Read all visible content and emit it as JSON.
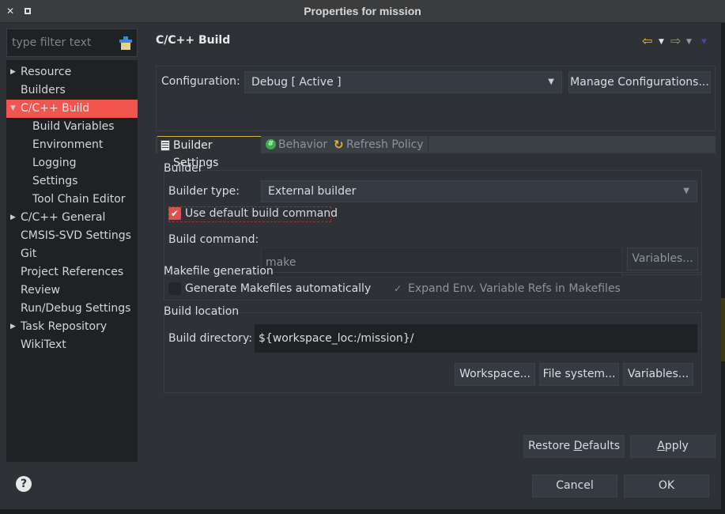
{
  "window": {
    "title": "Properties for mission",
    "close_glyph": "✕",
    "maximize_glyph": ""
  },
  "sidebar": {
    "filter_placeholder": "type filter text",
    "items": [
      {
        "label": "Resource",
        "level": 0,
        "expandable": true,
        "expanded": false
      },
      {
        "label": "Builders",
        "level": 0,
        "expandable": false
      },
      {
        "label": "C/C++ Build",
        "level": 0,
        "expandable": true,
        "expanded": true,
        "selected": true
      },
      {
        "label": "Build Variables",
        "level": 1
      },
      {
        "label": "Environment",
        "level": 1
      },
      {
        "label": "Logging",
        "level": 1
      },
      {
        "label": "Settings",
        "level": 1
      },
      {
        "label": "Tool Chain Editor",
        "level": 1
      },
      {
        "label": "C/C++ General",
        "level": 0,
        "expandable": true,
        "expanded": false
      },
      {
        "label": "CMSIS-SVD Settings",
        "level": 0
      },
      {
        "label": "Git",
        "level": 0
      },
      {
        "label": "Project References",
        "level": 0
      },
      {
        "label": "Review",
        "level": 0
      },
      {
        "label": "Run/Debug Settings",
        "level": 0
      },
      {
        "label": "Task Repository",
        "level": 0,
        "expandable": true,
        "expanded": false
      },
      {
        "label": "WikiText",
        "level": 0
      }
    ],
    "arrow_collapsed": "▶",
    "arrow_expanded": "▼",
    "help_glyph": "?"
  },
  "page": {
    "title": "C/C++ Build",
    "nav": {
      "back_glyph": "⇦",
      "forward_glyph": "⇨",
      "dropdown_glyph": "▼"
    }
  },
  "configuration": {
    "label": "Configuration:",
    "value": "Debug  [ Active ]",
    "manage_button": "Manage Configurations..."
  },
  "tabs": [
    {
      "label": "Builder Settings",
      "active": true
    },
    {
      "label": "Behavior",
      "active": false
    },
    {
      "label": "Refresh Policy",
      "active": false
    }
  ],
  "builder": {
    "group_label": "Builder",
    "type_label": "Builder type:",
    "type_value": "External builder",
    "use_default_label": "Use default build command",
    "use_default_checked": true,
    "command_label": "Build command:",
    "command_value": "make",
    "variables_button": "Variables..."
  },
  "makefile": {
    "group_label": "Makefile generation",
    "generate_label": "Generate Makefiles automatically",
    "generate_checked": false,
    "expand_label": "Expand Env. Variable Refs in Makefiles",
    "expand_checked": true,
    "expand_enabled": false
  },
  "location": {
    "group_label": "Build location",
    "directory_label": "Build directory:",
    "directory_value": "${workspace_loc:/mission}/",
    "workspace_button": "Workspace...",
    "filesystem_button": "File system...",
    "variables_button": "Variables..."
  },
  "footer": {
    "restore_prefix": "Restore ",
    "restore_mnemonic": "D",
    "restore_suffix": "efaults",
    "apply_mnemonic": "A",
    "apply_suffix": "pply",
    "cancel": "Cancel",
    "ok": "OK"
  },
  "colors": {
    "selection": "#f0554f",
    "checkbox_checked": "#e0504c",
    "active_tab_accent": "#d9b24a",
    "dialog_bg": "#2e3237",
    "tree_bg": "#1f2225"
  }
}
